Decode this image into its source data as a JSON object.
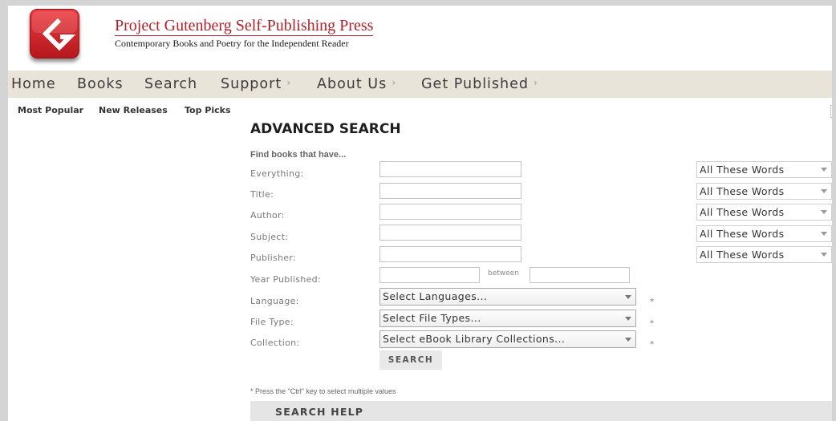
{
  "header": {
    "title": "Project Gutenberg Self-Publishing Press",
    "tagline": "Contemporary Books and Poetry for the Independent Reader"
  },
  "nav": {
    "items": [
      {
        "label": "Home"
      },
      {
        "label": "Books"
      },
      {
        "label": "Search"
      },
      {
        "label": "Support",
        "arrow": "›"
      },
      {
        "label": "About Us",
        "arrow": "›"
      },
      {
        "label": "Get Published",
        "arrow": "›"
      }
    ]
  },
  "subnav": {
    "items": [
      {
        "label": "Most Popular"
      },
      {
        "label": "New Releases"
      },
      {
        "label": "Top Picks"
      }
    ]
  },
  "advanced_search": {
    "heading": "ADVANCED SEARCH",
    "intro": "Find books that have...",
    "text_fields": [
      {
        "label": "Everything:",
        "match": "All These Words"
      },
      {
        "label": "Title:",
        "match": "All These Words"
      },
      {
        "label": "Author:",
        "match": "All These Words"
      },
      {
        "label": "Subject:",
        "match": "All These Words"
      },
      {
        "label": "Publisher:",
        "match": "All These Words"
      }
    ],
    "year_published": {
      "label": "Year Published:",
      "between_label": "between"
    },
    "multi_selects": [
      {
        "label": "Language:",
        "selected": "Select Languages...",
        "marker": "*"
      },
      {
        "label": "File Type:",
        "selected": "Select File Types...",
        "marker": "*"
      },
      {
        "label": "Collection:",
        "selected": "Select eBook Library Collections...",
        "marker": "*"
      }
    ],
    "submit_label": "SEARCH",
    "footnote": "* Press the \"Ctrl\" key to select multiple values"
  },
  "search_help": {
    "title": "SEARCH HELP"
  },
  "icons": {
    "logo": "gutenberg-logo-icon",
    "select_arrow": "dropdown-arrow-icon",
    "nav_submenu": "submenu-arrow-icon"
  },
  "colors": {
    "brand_red": "#b3202a",
    "logo_red": "#d42a2f",
    "nav_background": "#e8e4d9",
    "frame": "#d4d4d4",
    "button_background": "#e9e9e9",
    "help_bar_background": "#e5e5e5"
  }
}
